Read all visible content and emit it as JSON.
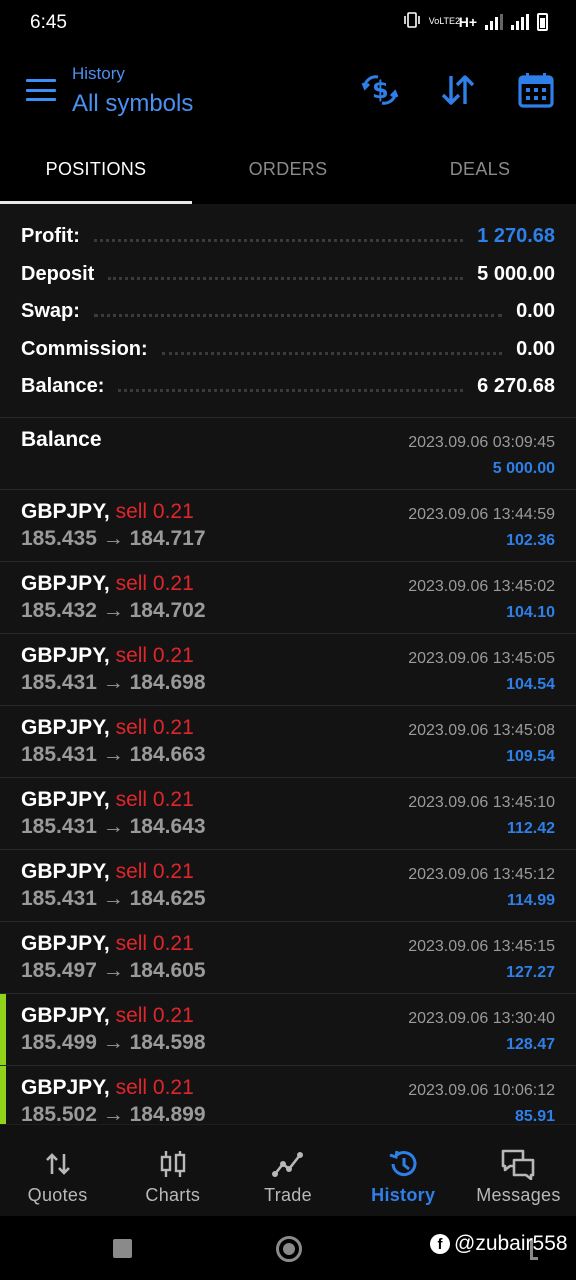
{
  "status": {
    "time": "6:45",
    "network_label": "H+",
    "volte_label": "VoLTE2"
  },
  "header": {
    "subtitle": "History",
    "title": "All symbols",
    "actions": [
      "currency-exchange-icon",
      "sort-icon",
      "calendar-icon"
    ]
  },
  "tabs": [
    {
      "label": "POSITIONS",
      "active": true
    },
    {
      "label": "ORDERS",
      "active": false
    },
    {
      "label": "DEALS",
      "active": false
    }
  ],
  "summary": {
    "profit": {
      "label": "Profit:",
      "value": "1 270.68"
    },
    "deposit": {
      "label": "Deposit",
      "value": "5 000.00"
    },
    "swap": {
      "label": "Swap:",
      "value": "0.00"
    },
    "commission": {
      "label": "Commission:",
      "value": "0.00"
    },
    "balance": {
      "label": "Balance:",
      "value": "6 270.68"
    }
  },
  "balance_entry": {
    "title": "Balance",
    "time": "2023.09.06 03:09:45",
    "amount": "5 000.00"
  },
  "positions": [
    {
      "symbol": "GBPJPY,",
      "side": "sell 0.21",
      "open": "185.435",
      "close": "184.717",
      "arrow": "→",
      "time": "2023.09.06 13:44:59",
      "profit": "102.36",
      "marked": false
    },
    {
      "symbol": "GBPJPY,",
      "side": "sell 0.21",
      "open": "185.432",
      "close": "184.702",
      "arrow": "→",
      "time": "2023.09.06 13:45:02",
      "profit": "104.10",
      "marked": false
    },
    {
      "symbol": "GBPJPY,",
      "side": "sell 0.21",
      "open": "185.431",
      "close": "184.698",
      "arrow": "→",
      "time": "2023.09.06 13:45:05",
      "profit": "104.54",
      "marked": false
    },
    {
      "symbol": "GBPJPY,",
      "side": "sell 0.21",
      "open": "185.431",
      "close": "184.663",
      "arrow": "→",
      "time": "2023.09.06 13:45:08",
      "profit": "109.54",
      "marked": false
    },
    {
      "symbol": "GBPJPY,",
      "side": "sell 0.21",
      "open": "185.431",
      "close": "184.643",
      "arrow": "→",
      "time": "2023.09.06 13:45:10",
      "profit": "112.42",
      "marked": false
    },
    {
      "symbol": "GBPJPY,",
      "side": "sell 0.21",
      "open": "185.431",
      "close": "184.625",
      "arrow": "→",
      "time": "2023.09.06 13:45:12",
      "profit": "114.99",
      "marked": false
    },
    {
      "symbol": "GBPJPY,",
      "side": "sell 0.21",
      "open": "185.497",
      "close": "184.605",
      "arrow": "→",
      "time": "2023.09.06 13:45:15",
      "profit": "127.27",
      "marked": false
    },
    {
      "symbol": "GBPJPY,",
      "side": "sell 0.21",
      "open": "185.499",
      "close": "184.598",
      "arrow": "→",
      "time": "2023.09.06 13:30:40",
      "profit": "128.47",
      "marked": true
    },
    {
      "symbol": "GBPJPY,",
      "side": "sell 0.21",
      "open": "185.502",
      "close": "184.899",
      "arrow": "→",
      "time": "2023.09.06 10:06:12",
      "profit": "85.91",
      "marked": true
    }
  ],
  "bottom_nav": [
    {
      "label": "Quotes",
      "icon": "quotes-arrows-icon",
      "active": false
    },
    {
      "label": "Charts",
      "icon": "candlestick-icon",
      "active": false
    },
    {
      "label": "Trade",
      "icon": "trend-line-icon",
      "active": false
    },
    {
      "label": "History",
      "icon": "history-clock-icon",
      "active": true
    },
    {
      "label": "Messages",
      "icon": "chat-bubbles-icon",
      "active": false
    }
  ],
  "watermark": "@zubair558",
  "colors": {
    "accent_blue": "#2f7fe8",
    "sell_red": "#e0262b",
    "marker_green": "#8fd41a",
    "background": "#131313"
  }
}
